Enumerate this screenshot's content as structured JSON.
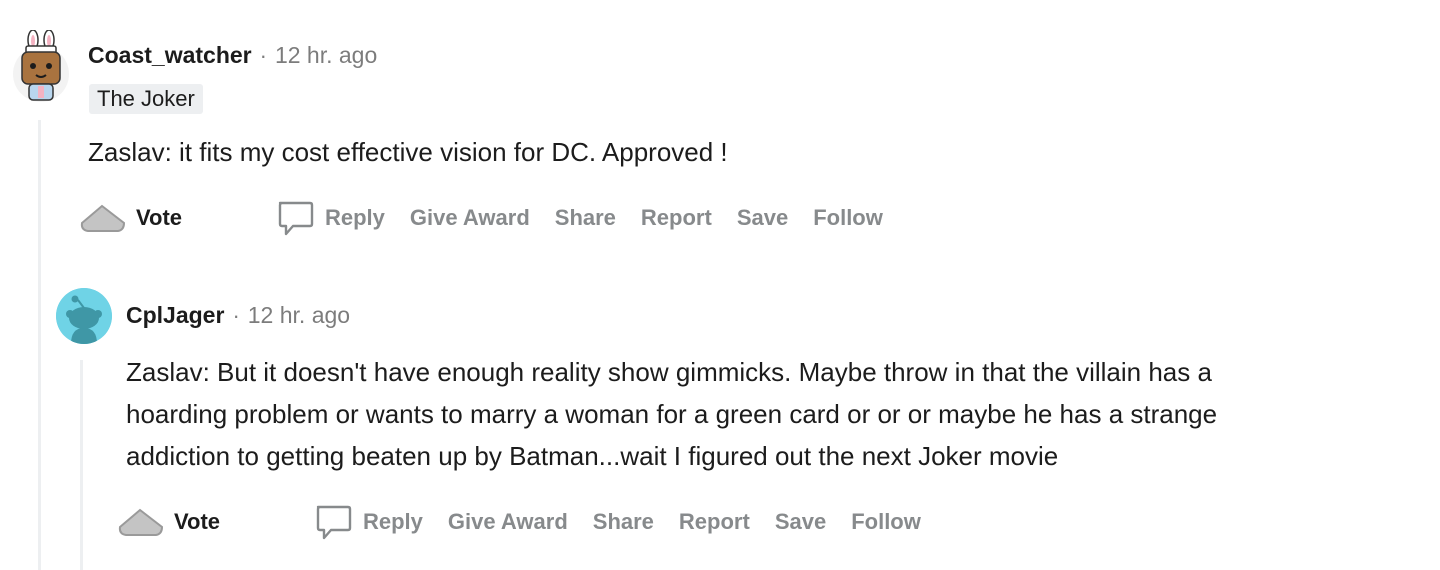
{
  "comments": [
    {
      "username": "Coast_watcher",
      "separator": "·",
      "timestamp": "12 hr. ago",
      "flair": "The Joker",
      "body": [
        "Zaslav: it fits my cost effective vision for DC. Approved !"
      ],
      "actions": {
        "vote": "Vote",
        "reply": "Reply",
        "give_award": "Give Award",
        "share": "Share",
        "report": "Report",
        "save": "Save",
        "follow": "Follow"
      }
    },
    {
      "username": "CplJager",
      "separator": "·",
      "timestamp": "12 hr. ago",
      "body": [
        "Zaslav: But it doesn't have enough reality show gimmicks. Maybe throw in that the villain has a",
        "hoarding problem or wants to marry a woman for a green card or or or maybe he has a strange",
        "addiction to getting beaten up by Batman...wait I figured out the next Joker movie"
      ],
      "actions": {
        "vote": "Vote",
        "reply": "Reply",
        "give_award": "Give Award",
        "share": "Share",
        "report": "Report",
        "save": "Save",
        "follow": "Follow"
      }
    }
  ],
  "colors": {
    "thread_line": "#edeff1",
    "meta_text": "#7c7c7c",
    "action_text": "#878a8c",
    "snoo_background": "#6fd3e6",
    "snoo_body": "#3f97a6"
  }
}
